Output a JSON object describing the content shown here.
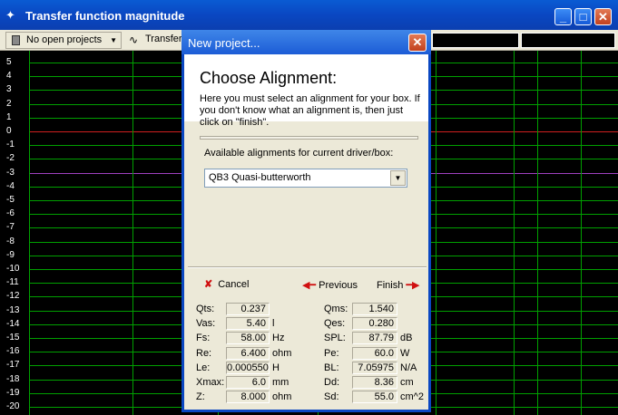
{
  "window": {
    "title": "Transfer function magnitude",
    "icon": "crosshair-icon"
  },
  "toolbar": {
    "project_label": "No open projects",
    "transfer_label": "Transfer"
  },
  "plot": {
    "y_labels": [
      "5",
      "4",
      "3",
      "2",
      "1",
      "0",
      "-1",
      "-2",
      "-3",
      "-4",
      "-5",
      "-6",
      "-7",
      "-8",
      "-9",
      "-10",
      "-11",
      "-12",
      "-13",
      "-14",
      "-15",
      "-16",
      "-17",
      "-18",
      "-19",
      "-20"
    ],
    "colors": {
      "grid": "#00a000",
      "zero_line": "#d02020",
      "minus3_line": "#a040c0",
      "background": "#000000"
    }
  },
  "dialog": {
    "title": "New project...",
    "heading": "Choose Alignment:",
    "description": "Here you must select an alignment for your box. If you don't know what an alignment is, then just click on \"finish\".",
    "available_label": "Available alignments for current driver/box:",
    "selected_alignment": "QB3 Quasi-butterworth",
    "cancel_label": "Cancel",
    "previous_label": "Previous",
    "finish_label": "Finish",
    "params_left": [
      {
        "label": "Qts:",
        "value": "0.237",
        "unit": ""
      },
      {
        "label": "Vas:",
        "value": "5.40",
        "unit": "l"
      },
      {
        "label": "Fs:",
        "value": "58.00",
        "unit": "Hz"
      },
      {
        "label": "Re:",
        "value": "6.400",
        "unit": "ohm"
      },
      {
        "label": "Le:",
        "value": "0.000550",
        "unit": "H"
      },
      {
        "label": "Xmax:",
        "value": "6.0",
        "unit": "mm"
      },
      {
        "label": "Z:",
        "value": "8.000",
        "unit": "ohm"
      }
    ],
    "params_right": [
      {
        "label": "Qms:",
        "value": "1.540",
        "unit": ""
      },
      {
        "label": "Qes:",
        "value": "0.280",
        "unit": ""
      },
      {
        "label": "SPL:",
        "value": "87.79",
        "unit": "dB"
      },
      {
        "label": "Pe:",
        "value": "60.0",
        "unit": "W"
      },
      {
        "label": "BL:",
        "value": "7.05975",
        "unit": "N/A"
      },
      {
        "label": "Dd:",
        "value": "8.36",
        "unit": "cm"
      },
      {
        "label": "Sd:",
        "value": "55.0",
        "unit": "cm^2"
      }
    ]
  }
}
